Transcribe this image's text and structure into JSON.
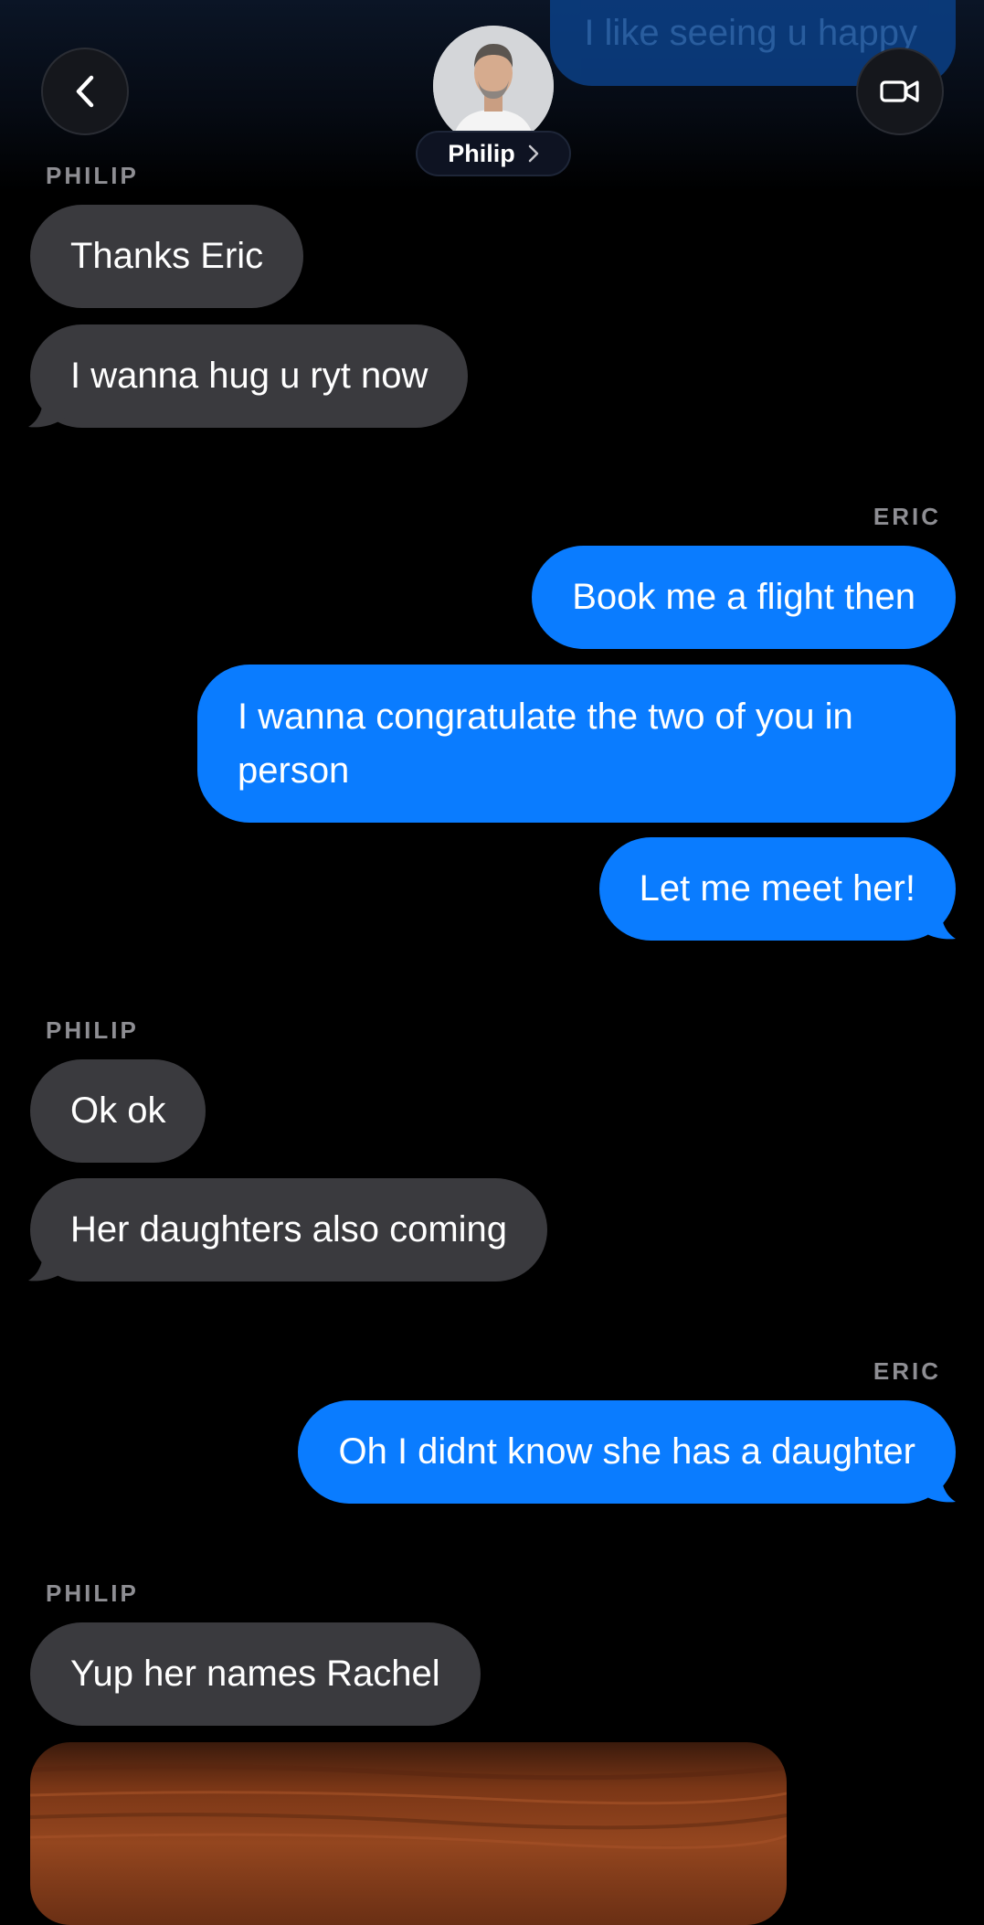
{
  "header": {
    "contact_name": "Philip",
    "back_icon": "chevron-left-icon",
    "video_icon": "video-camera-icon",
    "name_chevron_icon": "chevron-right-icon",
    "partial_message": "I like seeing u happy"
  },
  "colors": {
    "sent_bubble": "#0a7cff",
    "received_bubble": "#3a3a3e",
    "sender_label": "#8e8e93",
    "background": "#000000"
  },
  "messages": [
    {
      "sender": "PHILIP",
      "bubbles": [
        "Thanks Eric",
        "I wanna hug u ryt now"
      ]
    },
    {
      "sender": "ERIC",
      "bubbles": [
        "Book me a flight then",
        "I wanna congratulate the two of you in person",
        "Let me meet her!"
      ]
    },
    {
      "sender": "PHILIP",
      "bubbles": [
        "Ok ok",
        "Her daughters also coming"
      ]
    },
    {
      "sender": "ERIC",
      "bubbles": [
        "Oh I didnt know she has a daughter"
      ]
    },
    {
      "sender": "PHILIP",
      "bubbles": [
        "Yup her names Rachel"
      ]
    }
  ]
}
